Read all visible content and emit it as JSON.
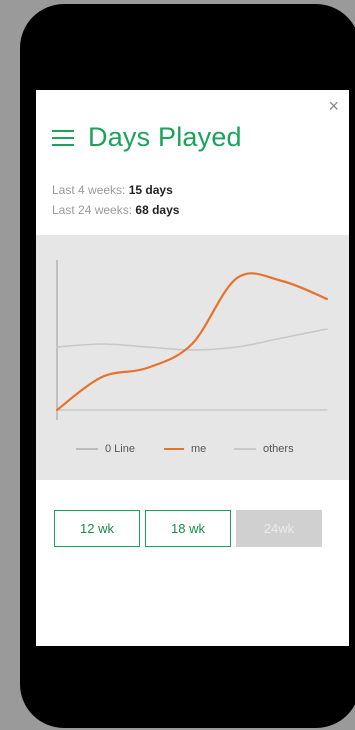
{
  "header": {
    "title": "Days Played",
    "close_glyph": "×",
    "menu_icon": "menu-icon",
    "close_icon": "close-icon"
  },
  "stats": {
    "last4_label": "Last 4 weeks:",
    "last4_value": "15 days",
    "last24_label": "Last 24 weeks:",
    "last24_value": "68 days"
  },
  "colors": {
    "accent": "#1aa35a",
    "me": "#e8722a",
    "others": "#c8c8c8",
    "zero_line": "#bbbbbb"
  },
  "chart_data": {
    "type": "line",
    "series": [
      {
        "name": "0 Line",
        "values": [
          0,
          0,
          0,
          0,
          0,
          0,
          0
        ]
      },
      {
        "name": "me",
        "values": [
          0,
          11,
          14,
          22,
          44,
          43,
          37
        ]
      },
      {
        "name": "others",
        "values": [
          21,
          22,
          21,
          20,
          21,
          24,
          27
        ]
      }
    ],
    "ylim": [
      0,
      50
    ],
    "legend_position": "bottom",
    "grid": false
  },
  "legend": [
    "0 Line",
    "me",
    "others"
  ],
  "range_buttons": [
    {
      "label": "12 wk",
      "active": false
    },
    {
      "label": "18 wk",
      "active": false
    },
    {
      "label": "24wk",
      "active": true
    }
  ]
}
